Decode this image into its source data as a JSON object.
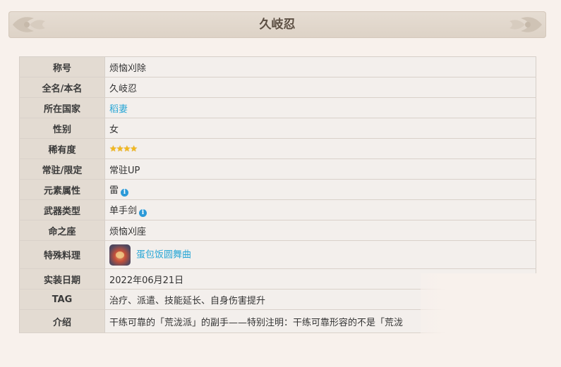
{
  "header": {
    "title": "久岐忍"
  },
  "rows": [
    {
      "label": "称号",
      "value": "烦恼刈除"
    },
    {
      "label": "全名/本名",
      "value": "久岐忍"
    },
    {
      "label": "所在国家",
      "value": "稻妻"
    },
    {
      "label": "性别",
      "value": "女"
    },
    {
      "label": "稀有度",
      "value": "★★★★",
      "stars": 4
    },
    {
      "label": "常驻/限定",
      "value": "常驻UP"
    },
    {
      "label": "元素属性",
      "value": "雷"
    },
    {
      "label": "武器类型",
      "value": "单手剑"
    },
    {
      "label": "命之座",
      "value": "烦恼刈座"
    },
    {
      "label": "特殊料理",
      "value": "蛋包饭圆舞曲"
    },
    {
      "label": "实装日期",
      "value": "2022年06月21日"
    },
    {
      "label": "TAG",
      "value": "治疗、派遣、技能延长、自身伤害提升"
    },
    {
      "label": "介绍",
      "value": "干练可靠的「荒泷派」的副手——特别注明：干练可靠形容的不是「荒泷"
    }
  ],
  "icons": {
    "info": "info-icon",
    "dish": "dish-thumbnail"
  },
  "colors": {
    "link": "#2aa7d6",
    "label_bg": "#e3dbd2",
    "value_bg": "#f3efec",
    "header_bg": "#e0d6cb"
  }
}
